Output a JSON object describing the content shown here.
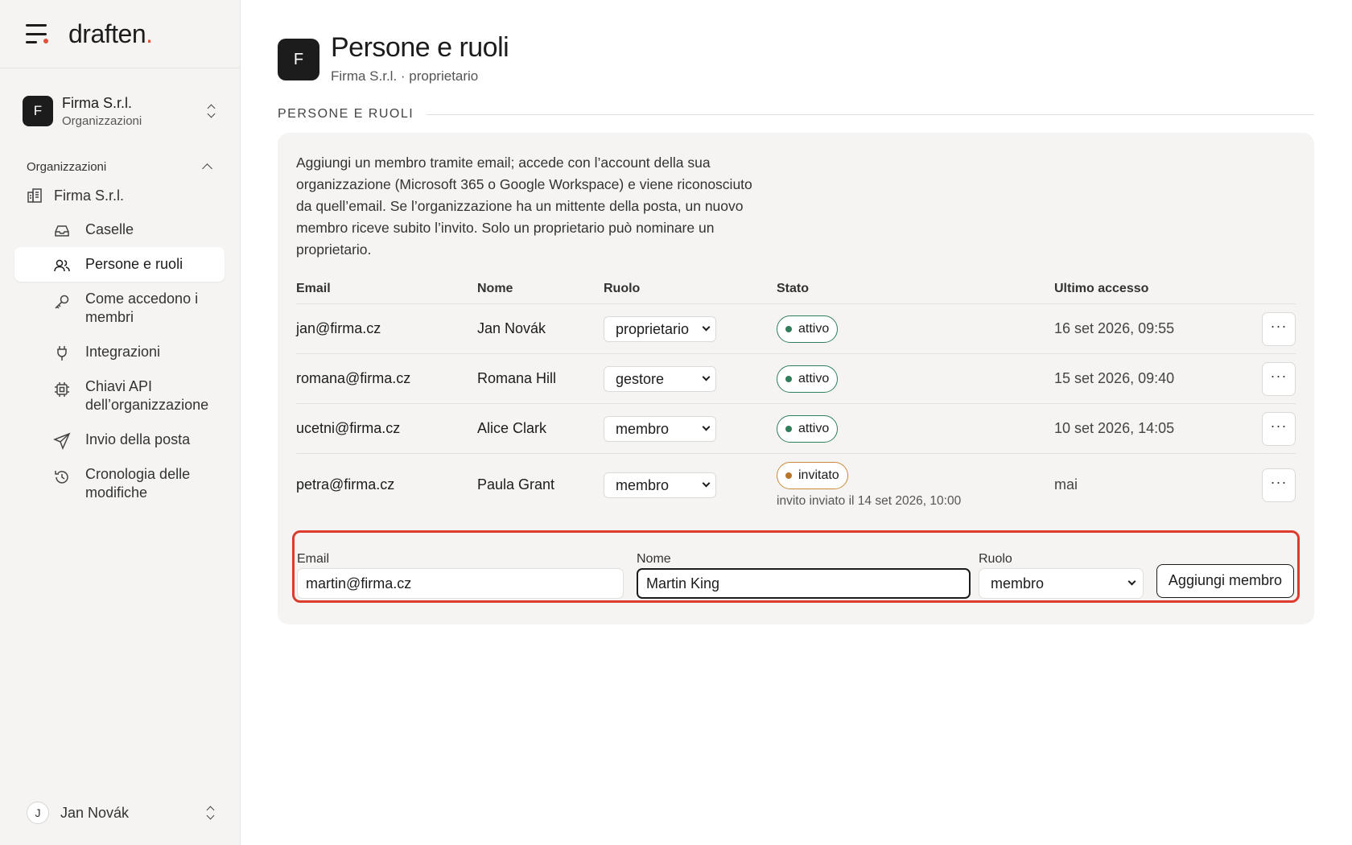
{
  "brand": {
    "name": "draften",
    "dot": "."
  },
  "org_switcher": {
    "initial": "F",
    "name": "Firma S.r.l.",
    "subtitle": "Organizzazioni"
  },
  "sidebar": {
    "section_label": "Organizzazioni",
    "org_item": "Firma S.r.l.",
    "items": [
      {
        "label": "Caselle",
        "icon": "inbox-icon"
      },
      {
        "label": "Persone e ruoli",
        "icon": "users-icon",
        "active": true
      },
      {
        "label": "Come accedono i membri",
        "icon": "key-icon"
      },
      {
        "label": "Integrazioni",
        "icon": "plug-icon"
      },
      {
        "label": "Chiavi API dell’organizzazione",
        "icon": "chip-icon"
      },
      {
        "label": "Invio della posta",
        "icon": "send-icon"
      },
      {
        "label": "Cronologia delle modifiche",
        "icon": "history-icon"
      }
    ]
  },
  "user": {
    "initial": "J",
    "name": "Jan Novák"
  },
  "page": {
    "initial": "F",
    "title": "Persone e ruoli",
    "subtitle": "Firma S.r.l. · proprietario",
    "section_title": "PERSONE E RUOLI",
    "intro": "Aggiungi un membro tramite email; accede con l’account della sua organizzazione (Microsoft 365 o Google Workspace) e viene riconosciuto da quell’email. Se l’organizzazione ha un mittente della posta, un nuovo membro riceve subito l’invito. Solo un proprietario può nominare un proprietario."
  },
  "table": {
    "headers": {
      "email": "Email",
      "name": "Nome",
      "role": "Ruolo",
      "state": "Stato",
      "last": "Ultimo accesso"
    },
    "more_label": "···",
    "rows": [
      {
        "email": "jan@firma.cz",
        "name": "Jan Novák",
        "role": "proprietario",
        "state": "attivo",
        "last": "16 set 2026, 09:55"
      },
      {
        "email": "romana@firma.cz",
        "name": "Romana Hill",
        "role": "gestore",
        "state": "attivo",
        "last": "15 set 2026, 09:40"
      },
      {
        "email": "ucetni@firma.cz",
        "name": "Alice Clark",
        "role": "membro",
        "state": "attivo",
        "last": "10 set 2026, 14:05"
      },
      {
        "email": "petra@firma.cz",
        "name": "Paula Grant",
        "role": "membro",
        "state": "invitato",
        "note": "invito inviato il 14 set 2026, 10:00",
        "last": "mai"
      }
    ]
  },
  "add_form": {
    "email_label": "Email",
    "email_value": "martin@firma.cz",
    "name_label": "Nome",
    "name_value": "Martin King",
    "role_label": "Ruolo",
    "role_value": "membro",
    "submit_label": "Aggiungi membro"
  },
  "colors": {
    "accent": "#e0503a",
    "active_green": "#2f7d5b",
    "invited_amber": "#c98a3a",
    "highlight_red": "#dd3b2e"
  }
}
